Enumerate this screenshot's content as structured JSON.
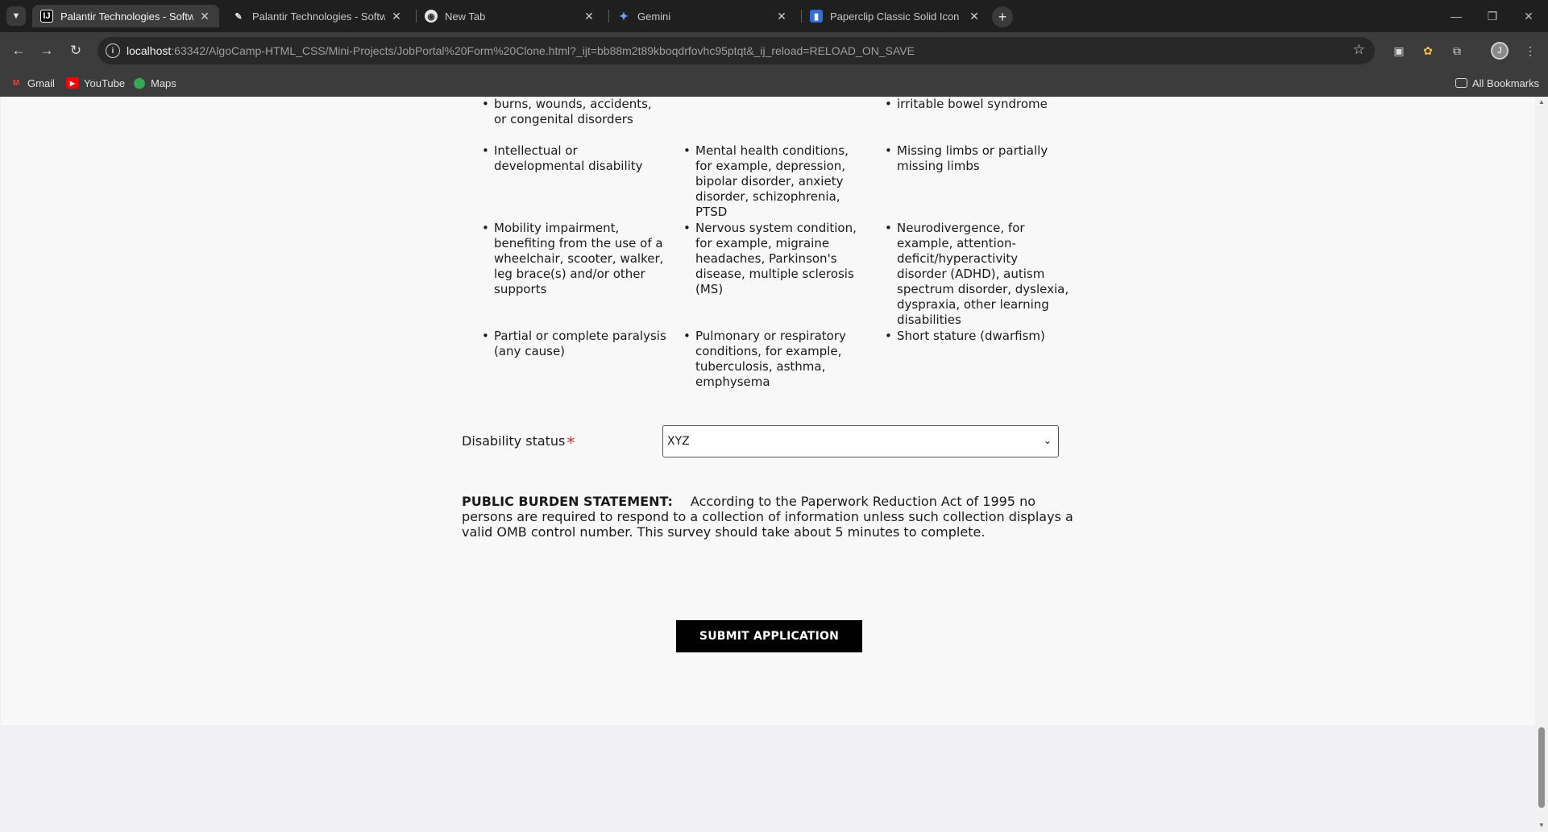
{
  "browser": {
    "tab_search_icon": "chevron-down",
    "tabs": [
      {
        "title": "Palantir Technologies - Software",
        "favicon": "intellij-icon"
      },
      {
        "title": "Palantir Technologies - Software",
        "favicon": "pen-icon"
      },
      {
        "title": "New Tab",
        "favicon": "chrome-icon"
      },
      {
        "title": "Gemini",
        "favicon": "gemini-star-icon"
      },
      {
        "title": "Paperclip Classic Solid Icon | Fo",
        "favicon": "bookmark-icon"
      }
    ],
    "new_tab_label": "+",
    "address": {
      "host": "localhost",
      "rest": ":63342/AlgoCamp-HTML_CSS/Mini-Projects/JobPortal%20Form%20Clone.html?_ijt=bb88m2t89kboqdrfovhc95ptqt&_ij_reload=RELOAD_ON_SAVE"
    },
    "bookmarks": [
      {
        "label": "Gmail",
        "icon": "gmail-icon"
      },
      {
        "label": "YouTube",
        "icon": "youtube-icon"
      },
      {
        "label": "Maps",
        "icon": "maps-icon"
      }
    ],
    "all_bookmarks_label": "All Bookmarks"
  },
  "page": {
    "conditions": {
      "col1": [
        "burns, wounds, accidents, or congenital disorders",
        "Intellectual or developmental disability",
        "Mobility impairment, benefiting from the use of a wheelchair, scooter, walker, leg brace(s) and/or other supports",
        "Partial or complete paralysis (any cause)"
      ],
      "col2": [
        "Mental health conditions, for example, depression, bipolar disorder, anxiety disorder, schizophrenia, PTSD",
        "Nervous system condition, for example, migraine headaches, Parkinson's disease, multiple sclerosis (MS)",
        "Pulmonary or respiratory conditions, for example, tuberculosis, asthma, emphysema"
      ],
      "col3": [
        "irritable bowel syndrome",
        "Missing limbs or partially missing limbs",
        "Neurodivergence, for example, attention-deficit/hyperactivity disorder (ADHD), autism spectrum disorder, dyslexia, dyspraxia, other learning disabilities",
        "Short stature (dwarfism)"
      ]
    },
    "disability_status": {
      "label": "Disability status",
      "required_mark": "*",
      "selected": "XYZ"
    },
    "public_burden": {
      "title": "PUBLIC BURDEN STATEMENT:",
      "text": "According to the Paperwork Reduction Act of 1995 no persons are required to respond to a collection of information unless such collection displays a valid OMB control number. This survey should take about 5 minutes to complete."
    },
    "submit_label": "SUBMIT APPLICATION"
  }
}
